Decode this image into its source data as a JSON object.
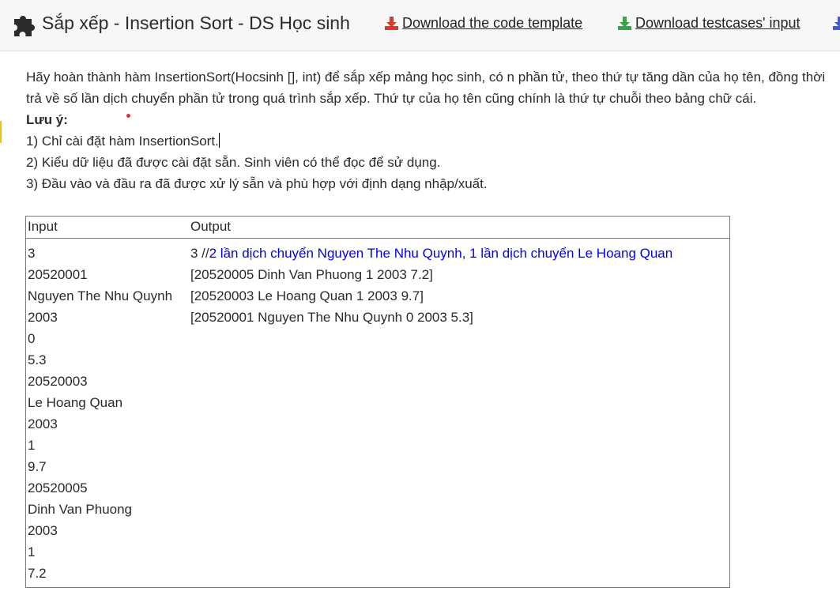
{
  "header": {
    "title": "Sắp xếp - Insertion Sort - DS Học sinh",
    "download_template": "Download the code template",
    "download_testcases": "Download testcases' input",
    "colors": {
      "download_template_icon": "#d93a2b",
      "download_testcases_icon": "#3aa34a",
      "third_icon": "#3f5bd0"
    }
  },
  "description": {
    "paragraph": "Hãy hoàn thành hàm InsertionSort(Hocsinh [], int) để sắp xếp mảng học sinh, có n phần tử, theo thứ tự tăng dần của họ tên, đồng thời trả về số lần dịch chuyển phần tử trong quá trình sắp xếp. Thứ tự của họ tên cũng chính là thứ tự chuỗi theo bảng chữ cái.",
    "note_label": "Lưu ý:",
    "notes": [
      "1) Chỉ cài đặt hàm InsertionSort.",
      "2) Kiểu dữ liệu đã được cài đặt sẵn. Sinh viên có thể đọc để sử dụng.",
      "3) Đầu vào và đầu ra đã được xử lý sẵn và phù hợp với định dạng nhập/xuất."
    ]
  },
  "table": {
    "headers": [
      "Input",
      "Output"
    ],
    "input_lines": [
      "3",
      "20520001",
      "Nguyen The Nhu Quynh",
      "2003",
      "0",
      "5.3",
      "20520003",
      "Le Hoang Quan",
      "2003",
      "1",
      "9.7",
      "20520005",
      "Dinh Van Phuong",
      "2003",
      "1",
      "7.2"
    ],
    "output_first_prefix": "3 //",
    "output_first_comment": "2 lần dịch chuyển Nguyen The Nhu Quynh, 1 lần dịch chuyển Le Hoang Quan",
    "output_lines": [
      "[20520005 Dinh Van Phuong 1 2003 7.2]",
      "[20520003 Le Hoang Quan 1 2003 9.7]",
      "[20520001 Nguyen The Nhu Quynh 0 2003 5.3]"
    ]
  }
}
